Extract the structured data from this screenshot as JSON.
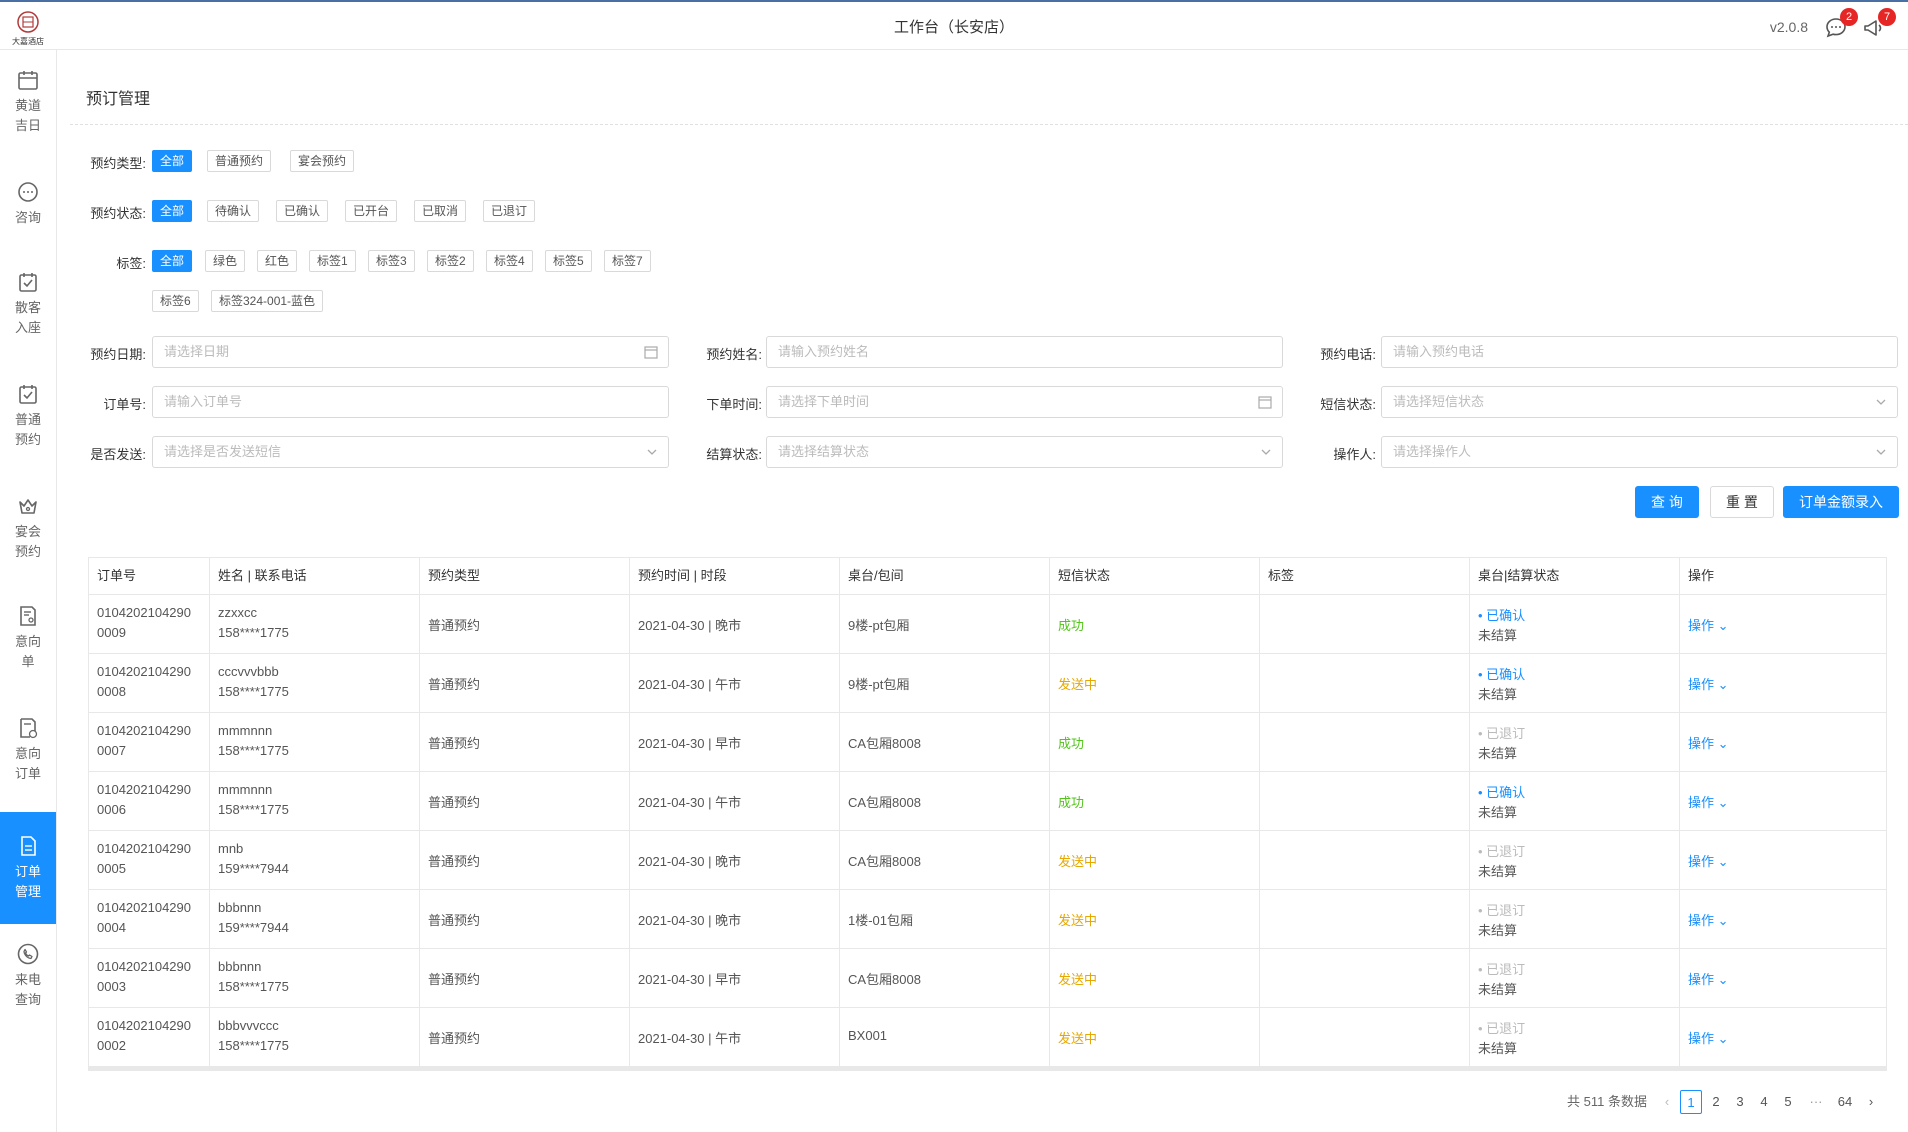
{
  "header": {
    "logo_text": "大嘉酒店",
    "title": "工作台（长安店）",
    "version": "v2.0.8",
    "chat_badge": "2",
    "notice_badge": "7"
  },
  "sidebar": {
    "items": [
      {
        "label": "黄道吉日",
        "icon": "calendar-icon"
      },
      {
        "label": "咨询",
        "icon": "chat-icon"
      },
      {
        "label": "散客入座",
        "icon": "checkbox-calendar-icon"
      },
      {
        "label": "普通预约",
        "icon": "checkbox-calendar-icon"
      },
      {
        "label": "宴会预约",
        "icon": "crown-icon"
      },
      {
        "label": "意向单",
        "icon": "document-user-icon"
      },
      {
        "label": "意向订单",
        "icon": "document-clock-icon"
      },
      {
        "label": "订单管理",
        "icon": "document-icon"
      },
      {
        "label": "来电查询",
        "icon": "phone-icon"
      }
    ],
    "active_index": 7
  },
  "page": {
    "title": "预订管理"
  },
  "filters": {
    "type_label": "预约类型:",
    "type_options": [
      "全部",
      "普通预约",
      "宴会预约"
    ],
    "status_label": "预约状态:",
    "status_options": [
      "全部",
      "待确认",
      "已确认",
      "已开台",
      "已取消",
      "已退订"
    ],
    "tag_label": "标签:",
    "tag_options": [
      "全部",
      "绿色",
      "红色",
      "标签1",
      "标签3",
      "标签2",
      "标签4",
      "标签5",
      "标签7",
      "标签6",
      "标签324-001-蓝色"
    ],
    "fields": {
      "date_label": "预约日期:",
      "date_placeholder": "请选择日期",
      "name_label": "预约姓名:",
      "name_placeholder": "请输入预约姓名",
      "phone_label": "预约电话:",
      "phone_placeholder": "请输入预约电话",
      "order_label": "订单号:",
      "order_placeholder": "请输入订单号",
      "time_label": "下单时间:",
      "time_placeholder": "请选择下单时间",
      "sms_label": "短信状态:",
      "sms_placeholder": "请选择短信状态",
      "send_label": "是否发送:",
      "send_placeholder": "请选择是否发送短信",
      "settle_label": "结算状态:",
      "settle_placeholder": "请选择结算状态",
      "operator_label": "操作人:",
      "operator_placeholder": "请选择操作人"
    },
    "buttons": {
      "query": "查 询",
      "reset": "重 置",
      "amount": "订单金额录入"
    }
  },
  "table": {
    "columns": [
      "订单号",
      "姓名 | 联系电话",
      "预约类型",
      "预约时间 | 时段",
      "桌台/包间",
      "短信状态",
      "标签",
      "桌台|结算状态",
      "操作"
    ],
    "rows": [
      {
        "order1": "0104202104290",
        "order2": "0009",
        "name": "zzxxcc",
        "phone": "158****1775",
        "type": "普通预约",
        "time": "2021-04-30 | 晚市",
        "table": "9楼-pt包厢",
        "sms": "成功",
        "sms_state": "ok",
        "tag": "",
        "status": "• 已确认",
        "status_state": "on",
        "settle": "未结算",
        "op": "操作 ⌄"
      },
      {
        "order1": "0104202104290",
        "order2": "0008",
        "name": "cccvvvbbb",
        "phone": "158****1775",
        "type": "普通预约",
        "time": "2021-04-30 | 午市",
        "table": "9楼-pt包厢",
        "sms": "发送中",
        "sms_state": "sending",
        "tag": "",
        "status": "• 已确认",
        "status_state": "on",
        "settle": "未结算",
        "op": "操作 ⌄"
      },
      {
        "order1": "0104202104290",
        "order2": "0007",
        "name": "mmmnnn",
        "phone": "158****1775",
        "type": "普通预约",
        "time": "2021-04-30 | 早市",
        "table": "CA包厢8008",
        "sms": "成功",
        "sms_state": "ok",
        "tag": "",
        "status": "• 已退订",
        "status_state": "off",
        "settle": "未结算",
        "op": "操作 ⌄"
      },
      {
        "order1": "0104202104290",
        "order2": "0006",
        "name": "mmmnnn",
        "phone": "158****1775",
        "type": "普通预约",
        "time": "2021-04-30 | 午市",
        "table": "CA包厢8008",
        "sms": "成功",
        "sms_state": "ok",
        "tag": "",
        "status": "• 已确认",
        "status_state": "on",
        "settle": "未结算",
        "op": "操作 ⌄"
      },
      {
        "order1": "0104202104290",
        "order2": "0005",
        "name": "mnb",
        "phone": "159****7944",
        "type": "普通预约",
        "time": "2021-04-30 | 晚市",
        "table": "CA包厢8008",
        "sms": "发送中",
        "sms_state": "sending",
        "tag": "",
        "status": "• 已退订",
        "status_state": "off",
        "settle": "未结算",
        "op": "操作 ⌄"
      },
      {
        "order1": "0104202104290",
        "order2": "0004",
        "name": "bbbnnn",
        "phone": "159****7944",
        "type": "普通预约",
        "time": "2021-04-30 | 晚市",
        "table": "1楼-01包厢",
        "sms": "发送中",
        "sms_state": "sending",
        "tag": "",
        "status": "• 已退订",
        "status_state": "off",
        "settle": "未结算",
        "op": "操作 ⌄"
      },
      {
        "order1": "0104202104290",
        "order2": "0003",
        "name": "bbbnnn",
        "phone": "158****1775",
        "type": "普通预约",
        "time": "2021-04-30 | 早市",
        "table": "CA包厢8008",
        "sms": "发送中",
        "sms_state": "sending",
        "tag": "",
        "status": "• 已退订",
        "status_state": "off",
        "settle": "未结算",
        "op": "操作 ⌄"
      },
      {
        "order1": "0104202104290",
        "order2": "0002",
        "name": "bbbvvvccc",
        "phone": "158****1775",
        "type": "普通预约",
        "time": "2021-04-30 | 午市",
        "table": "BX001",
        "sms": "发送中",
        "sms_state": "sending",
        "tag": "",
        "status": "• 已退订",
        "status_state": "off",
        "settle": "未结算",
        "op": "操作 ⌄"
      }
    ]
  },
  "pagination": {
    "total": "共 511 条数据",
    "prev": "‹",
    "pages": [
      "1",
      "2",
      "3",
      "4",
      "5"
    ],
    "ellipsis": "···",
    "last": "64",
    "next": "›",
    "current": "1"
  },
  "colors": {
    "primary": "#1890ff",
    "success": "#52c41a",
    "warning": "#e6a700",
    "badge": "#e62525"
  }
}
